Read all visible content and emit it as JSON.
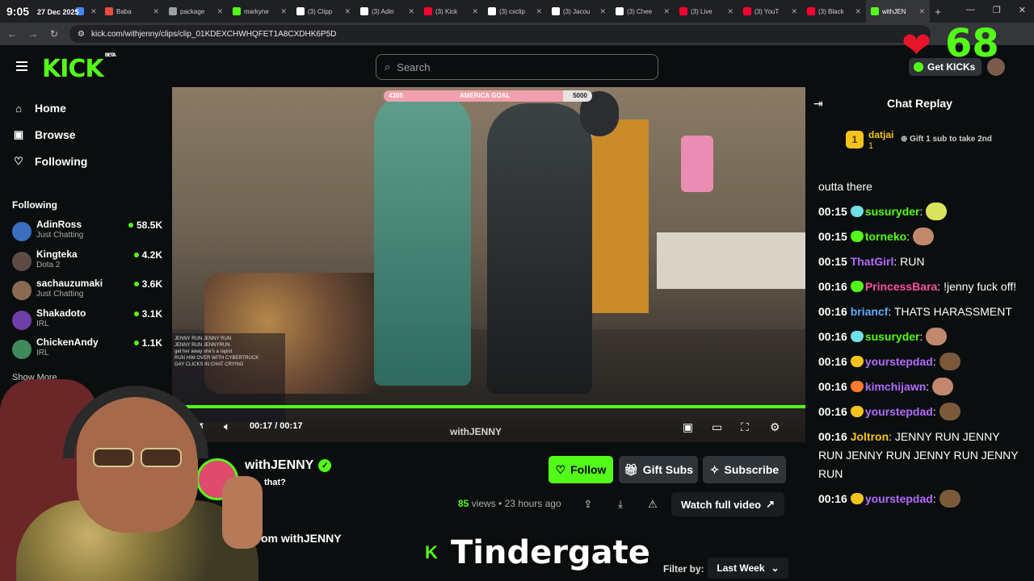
{
  "clock": {
    "time": "9:05",
    "date": "27 Dec 2025"
  },
  "tabs": [
    {
      "title": "Co",
      "color": "#4285f4",
      "active": false
    },
    {
      "title": "Baba",
      "color": "#e84c3d",
      "active": false
    },
    {
      "title": "package",
      "color": "#9aa0a6",
      "active": false
    },
    {
      "title": "markyne",
      "color": "#53fc18",
      "active": false
    },
    {
      "title": "(3) Clipp",
      "color": "#ffffff",
      "active": false
    },
    {
      "title": "(3) Adin",
      "color": "#ffffff",
      "active": false
    },
    {
      "title": "(3) Kick",
      "color": "#ff0033",
      "active": false
    },
    {
      "title": "(3) cxclip",
      "color": "#ffffff",
      "active": false
    },
    {
      "title": "(3) Jacou",
      "color": "#ffffff",
      "active": false
    },
    {
      "title": "(3) Chee",
      "color": "#ffffff",
      "active": false
    },
    {
      "title": "(3) Live",
      "color": "#ff0033",
      "active": false
    },
    {
      "title": "(3) YouT",
      "color": "#ff0033",
      "active": false
    },
    {
      "title": "(3) Black",
      "color": "#ff0033",
      "active": false
    },
    {
      "title": "withJEN",
      "color": "#53fc18",
      "active": true
    }
  ],
  "url": "kick.com/withjenny/clips/clip_01KDEXCHWHQFET1A8CXDHK6P5D",
  "header": {
    "logo": "KICK",
    "logo_sup": "BETA",
    "search_placeholder": "Search",
    "get_kicks": "Get KICKs"
  },
  "overlay": {
    "heart_count": "68"
  },
  "nav": [
    {
      "label": "Home",
      "icon": "home-icon",
      "glyph": "⌂"
    },
    {
      "label": "Browse",
      "icon": "browse-icon",
      "glyph": "▣"
    },
    {
      "label": "Following",
      "icon": "heart-outline-icon",
      "glyph": "♡"
    }
  ],
  "following": {
    "heading": "Following",
    "items": [
      {
        "name": "AdinRoss",
        "category": "Just Chatting",
        "viewers": "58.5K",
        "avatar": "#3a6fbf"
      },
      {
        "name": "Kingteka",
        "category": "Dota 2",
        "viewers": "4.2K",
        "avatar": "#5c4a44"
      },
      {
        "name": "sachauzumaki",
        "category": "Just Chatting",
        "viewers": "3.6K",
        "avatar": "#8a6b52"
      },
      {
        "name": "Shakadoto",
        "category": "IRL",
        "viewers": "3.1K",
        "avatar": "#6e3fa8"
      },
      {
        "name": "ChickenAndy",
        "category": "IRL",
        "viewers": "1.1K",
        "avatar": "#3f8a5a"
      }
    ],
    "show_more": "Show More"
  },
  "player": {
    "goal_current": "4305",
    "goal_label": "AMERICA GOAL",
    "goal_max": "5000",
    "goal_progress": 0.861,
    "time": "00:17 / 00:17",
    "progress": 1.0,
    "watermark": "withJENNY",
    "overlay_chat": [
      "JENNY RUN  JENNY RUN",
      "JENNY RUN  JENNYRUN",
      "get her away she's a rapist",
      "RUN HIM OVER WITH CYBERTRUCK",
      "GAY CLICKS IN CHAT CRYING"
    ]
  },
  "clip": {
    "channel": "withJENNY",
    "title": "that?",
    "follow": "Follow",
    "gift_subs": "Gift Subs",
    "subscribe": "Subscribe",
    "views": "85",
    "views_label": "views",
    "age": "• 23 hours ago",
    "watch_full": "Watch full video",
    "more_from": "om withJENNY",
    "filter_label": "Filter by:",
    "filter_value": "Last Week"
  },
  "chat": {
    "title": "Chat Replay",
    "pinned": {
      "rank": "1",
      "user": "datjai",
      "sub": "1",
      "gift_text": "Gift 1 sub to take 2nd"
    },
    "partial_top": "outta there",
    "messages": [
      {
        "time": "00:15",
        "user": "susuryder",
        "user_color": "#53fc18",
        "badge": "#6fe0e8",
        "text": "",
        "emote": "#d8e55c"
      },
      {
        "time": "00:15",
        "user": "torneko",
        "user_color": "#53fc18",
        "badge": "#53fc18",
        "text": "",
        "emote": "#c2886e"
      },
      {
        "time": "00:15",
        "user": "ThatGirl",
        "user_color": "#b36bff",
        "badge": "",
        "text": " RUN",
        "emote": ""
      },
      {
        "time": "00:16",
        "user": "PrincessBara",
        "user_color": "#ff4fa0",
        "badge": "#53fc18",
        "text": " !jenny fuck off!",
        "emote": ""
      },
      {
        "time": "00:16",
        "user": "briancf",
        "user_color": "#5fa8ff",
        "badge": "",
        "text": " THATS HARASSMENT",
        "emote": ""
      },
      {
        "time": "00:16",
        "user": "susuryder",
        "user_color": "#53fc18",
        "badge": "#6fe0e8",
        "text": "",
        "emote": "#c2886e"
      },
      {
        "time": "00:16",
        "user": "yourstepdad",
        "user_color": "#b36bff",
        "badge": "#f6c31c",
        "text": "",
        "emote": "#7a5a3a"
      },
      {
        "time": "00:16",
        "user": "kimchijawn",
        "user_color": "#b36bff",
        "badge": "#ff7a2e",
        "text": "",
        "emote": "#c2886e"
      },
      {
        "time": "00:16",
        "user": "yourstepdad",
        "user_color": "#b36bff",
        "badge": "#f6c31c",
        "text": "",
        "emote": "#7a5a3a"
      },
      {
        "time": "00:16",
        "user": "Joltron",
        "user_color": "#f6c31c",
        "badge": "",
        "text": " JENNY RUN  JENNY RUN  JENNY RUN  JENNY RUN  JENNY RUN",
        "emote": ""
      },
      {
        "time": "00:16",
        "user": "yourstepdad",
        "user_color": "#b36bff",
        "badge": "#f6c31c",
        "text": "",
        "emote": "#7a5a3a"
      }
    ]
  },
  "caption": {
    "k": "K",
    "text": "Tindergate"
  }
}
